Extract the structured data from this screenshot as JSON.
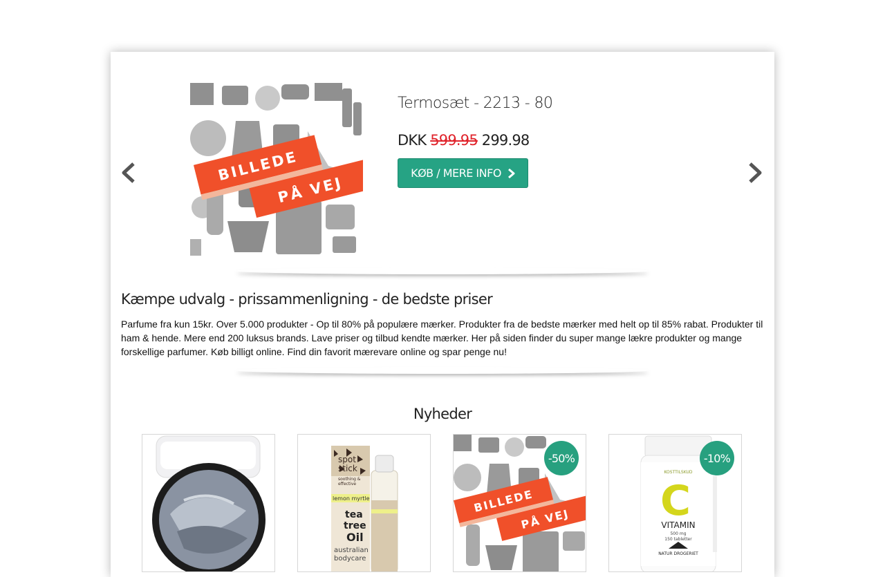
{
  "carousel": {
    "product_title": "Termosæt - 2213 - 80",
    "currency": "DKK",
    "old_price": "599.95",
    "new_price": "299.98",
    "buy_label": "KØB / MERE INFO",
    "placeholder_line1": "BILLEDE",
    "placeholder_line2": "PÅ VEJ",
    "prev_icon": "chevron-left-icon",
    "next_icon": "chevron-right-icon"
  },
  "intro": {
    "heading": "Kæmpe udvalg - prissammenligning - de bedste priser",
    "text": "Parfume fra kun 15kr. Over 5.000 produkter - Op til 80% på populære mærker. Produkter fra de bedste mærker med helt op til 85% rabat. Produkter til ham & hende. Mere end 200 luksus brands. Lave priser og tilbud kendte mærker. Her på siden finder du super mange lækre produkter og mange forskellige parfumer. Køb billigt online. Find din favorit mærevare online og spar penge nu!"
  },
  "news": {
    "heading": "Nyheder",
    "products": [
      {
        "kind": "eyeshadow",
        "badge": ""
      },
      {
        "kind": "spot-stick",
        "badge": "",
        "text_spot": "spot",
        "text_stick": "stick",
        "text_sub1": "soothing &",
        "text_sub2": "effective",
        "text_flavor": "lemon myrtle",
        "text_tea": "tea",
        "text_tree": "tree",
        "text_oil": "Oil",
        "text_brand1": "australian",
        "text_brand2": "bodycare"
      },
      {
        "kind": "placeholder",
        "badge": "-50%",
        "text_line1": "BILLEDE",
        "text_line2": "PÅ VEJ"
      },
      {
        "kind": "vitamin",
        "badge": "-10%",
        "text_letter": "C",
        "text_name": "VITAMIN",
        "text_dose": "500 mg",
        "text_count": "150 tabletter",
        "text_top": "KOSTTILSKUD",
        "text_brand": "NATUR DROGERIET"
      }
    ]
  },
  "colors": {
    "accent": "#26a384",
    "sale_red": "#e0232b",
    "ribbon": "#f0502a"
  }
}
